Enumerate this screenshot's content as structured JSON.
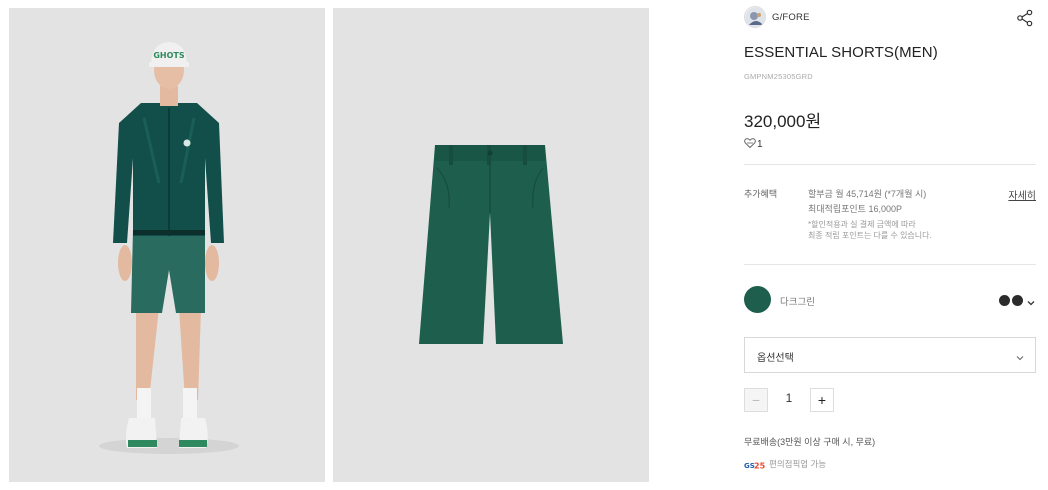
{
  "brand": {
    "name": "G/FORE",
    "logo_icon": "brand-logo-icon"
  },
  "product": {
    "title": "ESSENTIAL SHORTS(MEN)",
    "code": "GMPNM25305GRD",
    "price": "320,000원",
    "likes": "1"
  },
  "benefits": {
    "label": "추가혜택",
    "installment": "할부금 월 45,714원 (*7개월 시)",
    "points": "최대적립포인트 16,000P",
    "note_line1": "*할인적용과 실 결제 금액에 따라",
    "note_line2": "최종 적립 포인트는 다를 수 있습니다.",
    "detail_link": "자세히"
  },
  "color": {
    "name": "다크그린",
    "hex": "#1e5e4c"
  },
  "option_select": {
    "label": "옵션선택"
  },
  "quantity": {
    "value": "1",
    "minus": "−",
    "plus": "+"
  },
  "shipping": {
    "text": "무료배송(3만원 이상 구매 시, 무료)"
  },
  "convenience": {
    "logo": "GS25",
    "text": "편의점픽업 가능"
  }
}
